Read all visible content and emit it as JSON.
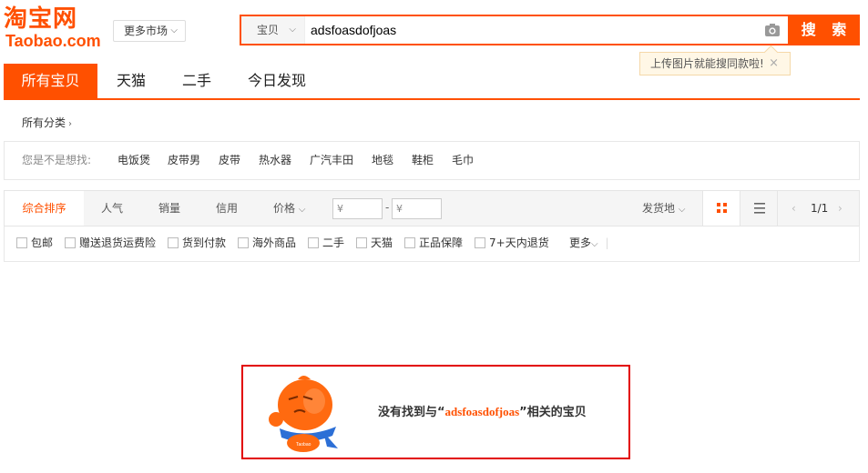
{
  "header": {
    "logo_cn": "淘宝网",
    "logo_en": "Taobao.com",
    "market_label": "更多市场",
    "search_type": "宝贝",
    "search_value": "adsfoasdofjoas",
    "search_button": "搜 索",
    "tooltip": "上传图片就能搜同款啦!",
    "tooltip_close": "×",
    "icons": {
      "camera": "camera-icon",
      "chevron": "chevron-down-icon",
      "close": "close-icon"
    }
  },
  "tabs": [
    "所有宝贝",
    "天猫",
    "二手",
    "今日发现"
  ],
  "category": {
    "label": "所有分类",
    "chevron": "›"
  },
  "suggest": {
    "label": "您是不是想找:",
    "items": [
      "电饭煲",
      "皮带男",
      "皮带",
      "热水器",
      "广汽丰田",
      "地毯",
      "鞋柜",
      "毛巾"
    ]
  },
  "sortbar": {
    "items": [
      "综合排序",
      "人气",
      "销量",
      "信用",
      "价格"
    ],
    "price_min_placeholder": "¥",
    "price_max_placeholder": "¥",
    "dash": "-",
    "location": "发货地",
    "pager": "1/1"
  },
  "filters": {
    "items": [
      "包邮",
      "赠送退货运费险",
      "货到付款",
      "海外商品",
      "二手",
      "天猫",
      "正品保障",
      "7+天内退货"
    ],
    "more": "更多"
  },
  "empty": {
    "prefix": "没有找到与“",
    "keyword": "adsfoasdofjoas",
    "suffix": "”相关的宝贝",
    "mascot_label": "Taobao"
  },
  "colors": {
    "accent": "#ff5000",
    "border_highlight": "#e20000"
  }
}
